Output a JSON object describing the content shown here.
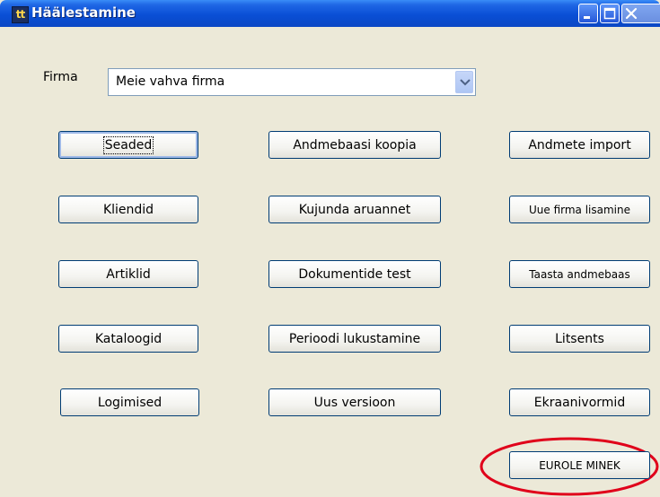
{
  "window": {
    "title": "Häälestamine",
    "icon_text": "tt"
  },
  "firma": {
    "label": "Firma",
    "selected": "Meie vahva firma"
  },
  "buttons": {
    "col1": [
      "Seaded",
      "Kliendid",
      "Artiklid",
      "Kataloogid",
      "Logimised"
    ],
    "col2": [
      "Andmebaasi koopia",
      "Kujunda aruannet",
      "Dokumentide test",
      "Perioodi lukustamine",
      "Uus versioon"
    ],
    "col3": [
      "Andmete import",
      "Uue firma lisamine",
      "Taasta andmebaas",
      "Litsents",
      "Ekraanivormid"
    ],
    "eurole": "EUROLE MINEK"
  },
  "colors": {
    "title_bar": "#0a4fd6",
    "highlight_ellipse": "#e0001a"
  }
}
